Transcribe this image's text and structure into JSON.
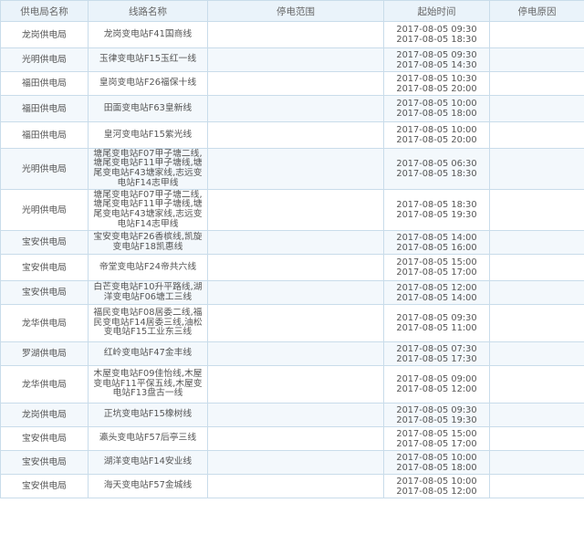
{
  "headers": {
    "bureau": "供电局名称",
    "line": "线路名称",
    "range": "停电范围",
    "time": "起始时间",
    "reason": "停电原因"
  },
  "rows": [
    {
      "bureau": "龙岗供电局",
      "line": "龙岗变电站F41国商线",
      "range": "",
      "start": "2017-08-05 09:30",
      "end": "2017-08-05 18:30",
      "reason": ""
    },
    {
      "bureau": "光明供电局",
      "line": "玉律变电站F15玉红一线",
      "range": "",
      "start": "2017-08-05 09:30",
      "end": "2017-08-05 14:30",
      "reason": ""
    },
    {
      "bureau": "福田供电局",
      "line": "皇岗变电站F26福保十线",
      "range": "",
      "start": "2017-08-05 10:30",
      "end": "2017-08-05 20:00",
      "reason": ""
    },
    {
      "bureau": "福田供电局",
      "line": "田面变电站F63皇新线",
      "range": "",
      "start": "2017-08-05 10:00",
      "end": "2017-08-05 18:00",
      "reason": ""
    },
    {
      "bureau": "福田供电局",
      "line": "皇河变电站F15紫光线",
      "range": "",
      "start": "2017-08-05 10:00",
      "end": "2017-08-05 20:00",
      "reason": ""
    },
    {
      "bureau": "光明供电局",
      "line": "塘尾变电站F07甲子塘二线,塘尾变电站F11甲子塘线,塘尾变电站F43塘家线,志远变电站F14志甲线",
      "range": "",
      "start": "2017-08-05 06:30",
      "end": "2017-08-05 18:30",
      "reason": ""
    },
    {
      "bureau": "光明供电局",
      "line": "塘尾变电站F07甲子塘二线,塘尾变电站F11甲子塘线,塘尾变电站F43塘家线,志远变电站F14志甲线",
      "range": "",
      "start": "2017-08-05 18:30",
      "end": "2017-08-05 19:30",
      "reason": ""
    },
    {
      "bureau": "宝安供电局",
      "line": "宝安变电站F26香槟线,凯旋变电站F18凯惠线",
      "range": "",
      "start": "2017-08-05 14:00",
      "end": "2017-08-05 16:00",
      "reason": ""
    },
    {
      "bureau": "宝安供电局",
      "line": "帝堂变电站F24帝共六线",
      "range": "",
      "start": "2017-08-05 15:00",
      "end": "2017-08-05 17:00",
      "reason": ""
    },
    {
      "bureau": "宝安供电局",
      "line": "白芒变电站F10升平路线,湖洋变电站F06塘工三线",
      "range": "",
      "start": "2017-08-05 12:00",
      "end": "2017-08-05 14:00",
      "reason": ""
    },
    {
      "bureau": "龙华供电局",
      "line": "福民变电站F08居委二线,福民变电站F14居委三线,油松变电站F15工业东三线",
      "range": "",
      "start": "2017-08-05 09:30",
      "end": "2017-08-05 11:00",
      "reason": ""
    },
    {
      "bureau": "罗湖供电局",
      "line": "红岭变电站F47金丰线",
      "range": "",
      "start": "2017-08-05 07:30",
      "end": "2017-08-05 17:30",
      "reason": ""
    },
    {
      "bureau": "龙华供电局",
      "line": "木屋变电站F09佳怡线,木屋变电站F11平保五线,木屋变电站F13盘古一线",
      "range": "",
      "start": "2017-08-05 09:00",
      "end": "2017-08-05 12:00",
      "reason": ""
    },
    {
      "bureau": "龙岗供电局",
      "line": "正坑变电站F15橡树线",
      "range": "",
      "start": "2017-08-05 09:30",
      "end": "2017-08-05 19:30",
      "reason": ""
    },
    {
      "bureau": "宝安供电局",
      "line": "瀛头变电站F57后亭三线",
      "range": "",
      "start": "2017-08-05 15:00",
      "end": "2017-08-05 17:00",
      "reason": ""
    },
    {
      "bureau": "宝安供电局",
      "line": "湖洋变电站F14安业线",
      "range": "",
      "start": "2017-08-05 10:00",
      "end": "2017-08-05 18:00",
      "reason": ""
    },
    {
      "bureau": "宝安供电局",
      "line": "海天变电站F57金城线",
      "range": "",
      "start": "2017-08-05 10:00",
      "end": "2017-08-05 12:00",
      "reason": ""
    }
  ]
}
